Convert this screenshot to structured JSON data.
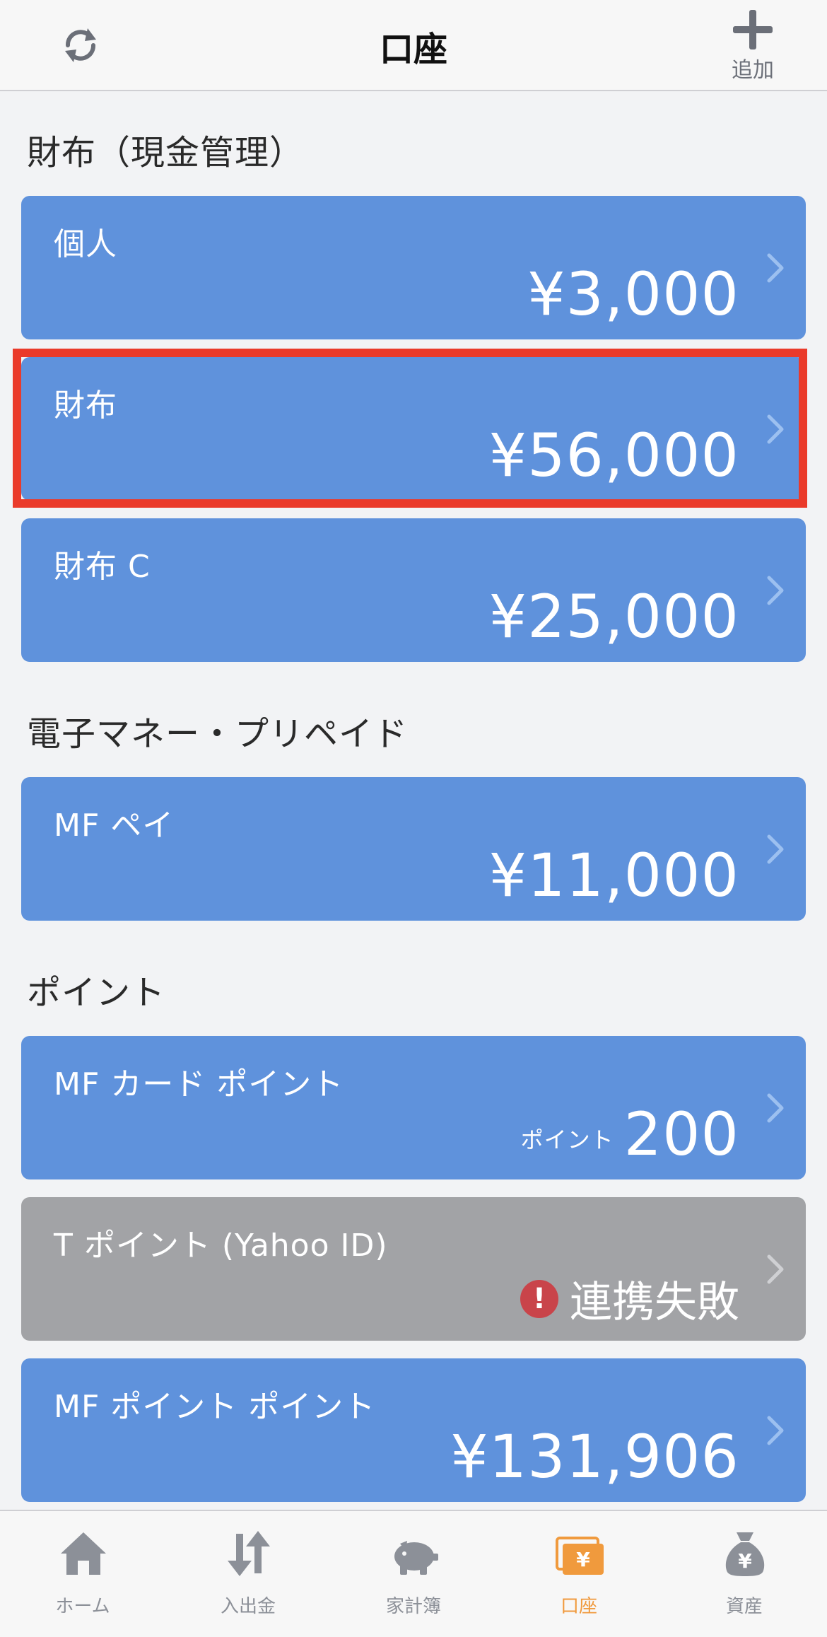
{
  "header": {
    "title": "口座",
    "add_label": "追加"
  },
  "sections": [
    {
      "title": "財布（現金管理）"
    },
    {
      "title": "電子マネー・プリペイド"
    },
    {
      "title": "ポイント"
    }
  ],
  "accounts": [
    {
      "name": "個人",
      "amount": "¥3,000"
    },
    {
      "name": "財布",
      "amount": "¥56,000"
    },
    {
      "name": "財布 C",
      "amount": "¥25,000"
    },
    {
      "name": "MF ペイ",
      "amount": "¥11,000"
    },
    {
      "name": "MF カード ポイント",
      "unit": "ポイント",
      "amount": "200"
    },
    {
      "name": "T ポイント (Yahoo ID)",
      "status": "連携失敗"
    },
    {
      "name": "MF ポイント ポイント",
      "amount": "¥131,906"
    }
  ],
  "tabs": [
    {
      "label": "ホーム"
    },
    {
      "label": "入出金"
    },
    {
      "label": "家計簿"
    },
    {
      "label": "口座"
    },
    {
      "label": "資産"
    }
  ],
  "colors": {
    "card_blue": "#5f92dc",
    "card_gray": "#a2a3a6",
    "highlight_red": "#ea3a2a",
    "active_tab": "#f09a3d",
    "inactive_tab": "#8c9098",
    "alert_red": "#c9444a"
  }
}
